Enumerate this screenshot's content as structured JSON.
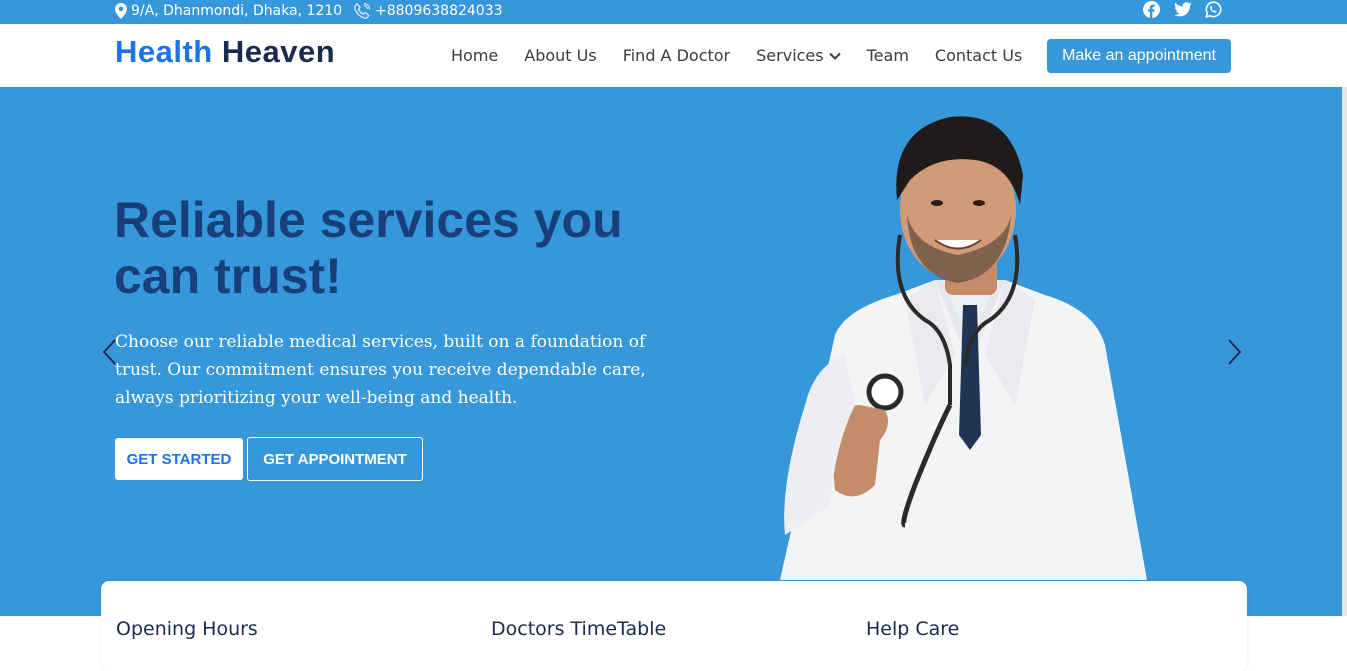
{
  "topbar": {
    "address": "9/A, Dhanmondi, Dhaka, 1210",
    "phone": "+8809638824033",
    "socials": [
      "facebook-icon",
      "twitter-icon",
      "whatsapp-icon"
    ]
  },
  "brand": {
    "part1": "Health",
    "part2": "Heaven",
    "color_primary": "#1a73e8",
    "color_dark": "#1b2b4d"
  },
  "nav": {
    "items": [
      "Home",
      "About Us",
      "Find A Doctor",
      "Services",
      "Team",
      "Contact Us"
    ],
    "cta": "Make an appointment"
  },
  "hero": {
    "title": "Reliable services you can trust!",
    "subtitle": "Choose our reliable medical services, built on a foundation of trust. Our commitment ensures you receive dependable care, always prioritizing your well-being and health.",
    "btn_primary": "GET STARTED",
    "btn_secondary": "GET APPOINTMENT",
    "bg_color": "#3797db"
  },
  "info": {
    "columns": [
      "Opening Hours",
      "Doctors TimeTable",
      "Help Care"
    ]
  }
}
